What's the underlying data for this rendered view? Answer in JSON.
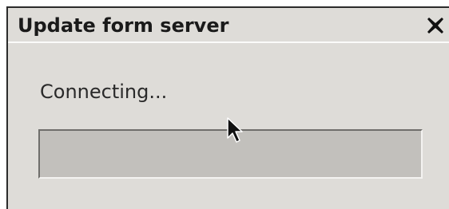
{
  "window": {
    "title": "Update form server",
    "close_icon": "close-x-icon"
  },
  "status": {
    "text": "Connecting..."
  },
  "progress": {
    "value": 0,
    "fill_color": "#6a88b8"
  },
  "cursor": {
    "icon": "arrow-pointer-icon"
  }
}
